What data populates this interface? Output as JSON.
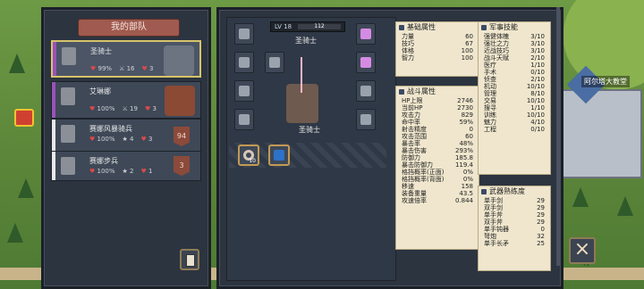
{
  "world": {
    "castle_label": "阿尔塔大教堂",
    "road_label": "村"
  },
  "team": {
    "title": "我的部队",
    "units": [
      {
        "name": "圣骑士",
        "hp": "99%",
        "atk": "16",
        "cnt": "3"
      },
      {
        "name": "艾琳娜",
        "hp": "100%",
        "atk": "19",
        "cnt": "3"
      },
      {
        "name": "赛娜风暴骑兵",
        "hp": "100%",
        "atk": "4",
        "cnt": "3",
        "level": "94"
      },
      {
        "name": "赛娜步兵",
        "hp": "100%",
        "atk": "2",
        "cnt": "1",
        "level": "3"
      }
    ]
  },
  "hero": {
    "level_label": "LV 18",
    "exp": "112",
    "name": "圣骑士",
    "label": "圣骑士"
  },
  "skills": [
    {
      "num": "10"
    },
    {
      "num": ""
    }
  ],
  "basic": {
    "title": "基础属性",
    "rows": [
      {
        "k": "力量",
        "v": "60"
      },
      {
        "k": "技巧",
        "v": "67"
      },
      {
        "k": "体格",
        "v": "100"
      },
      {
        "k": "智力",
        "v": "100"
      }
    ]
  },
  "combat": {
    "title": "战斗属性",
    "rows": [
      {
        "k": "HP上限",
        "v": "2746"
      },
      {
        "k": "当前HP",
        "v": "2730"
      },
      {
        "k": "攻击力",
        "v": "829"
      },
      {
        "k": "命中率",
        "v": "59%"
      },
      {
        "k": "射击精度",
        "v": "0"
      },
      {
        "k": "攻击范围",
        "v": "60"
      },
      {
        "k": "暴击率",
        "v": "48%"
      },
      {
        "k": "暴击伤害",
        "v": "293%"
      },
      {
        "k": "防御力",
        "v": "185.8"
      },
      {
        "k": "暴击防御力",
        "v": "119.4"
      },
      {
        "k": "格挡概率(正面)",
        "v": "0%"
      },
      {
        "k": "格挡概率(背面)",
        "v": "0%"
      },
      {
        "k": "移速",
        "v": "158"
      },
      {
        "k": "装备重量",
        "v": "43.5"
      },
      {
        "k": "攻速倍率",
        "v": "0.844"
      }
    ]
  },
  "military": {
    "title": "军事技能",
    "rows": [
      {
        "k": "强健体魄",
        "v": "3/10"
      },
      {
        "k": "强壮之力",
        "v": "3/10"
      },
      {
        "k": "近战技巧",
        "v": "3/10"
      },
      {
        "k": "战斗天赋",
        "v": "2/10"
      },
      {
        "k": "医疗",
        "v": "1/10"
      },
      {
        "k": "手术",
        "v": "0/10"
      },
      {
        "k": "侦查",
        "v": "2/10"
      },
      {
        "k": "机动",
        "v": "10/10"
      },
      {
        "k": "管理",
        "v": "8/10"
      },
      {
        "k": "交易",
        "v": "10/10"
      },
      {
        "k": "搜寻",
        "v": "1/10"
      },
      {
        "k": "训练",
        "v": "10/10"
      },
      {
        "k": "魅力",
        "v": "4/10"
      },
      {
        "k": "工程",
        "v": "0/10"
      }
    ]
  },
  "weapon": {
    "title": "武器熟练度",
    "rows": [
      {
        "k": "单手剑",
        "v": "29"
      },
      {
        "k": "双手剑",
        "v": "29"
      },
      {
        "k": "单手斧",
        "v": "29"
      },
      {
        "k": "双手斧",
        "v": "29"
      },
      {
        "k": "单手钝器",
        "v": "0"
      },
      {
        "k": "弩炮",
        "v": "32"
      },
      {
        "k": "单手长矛",
        "v": "25"
      }
    ]
  },
  "close_icon": "×"
}
